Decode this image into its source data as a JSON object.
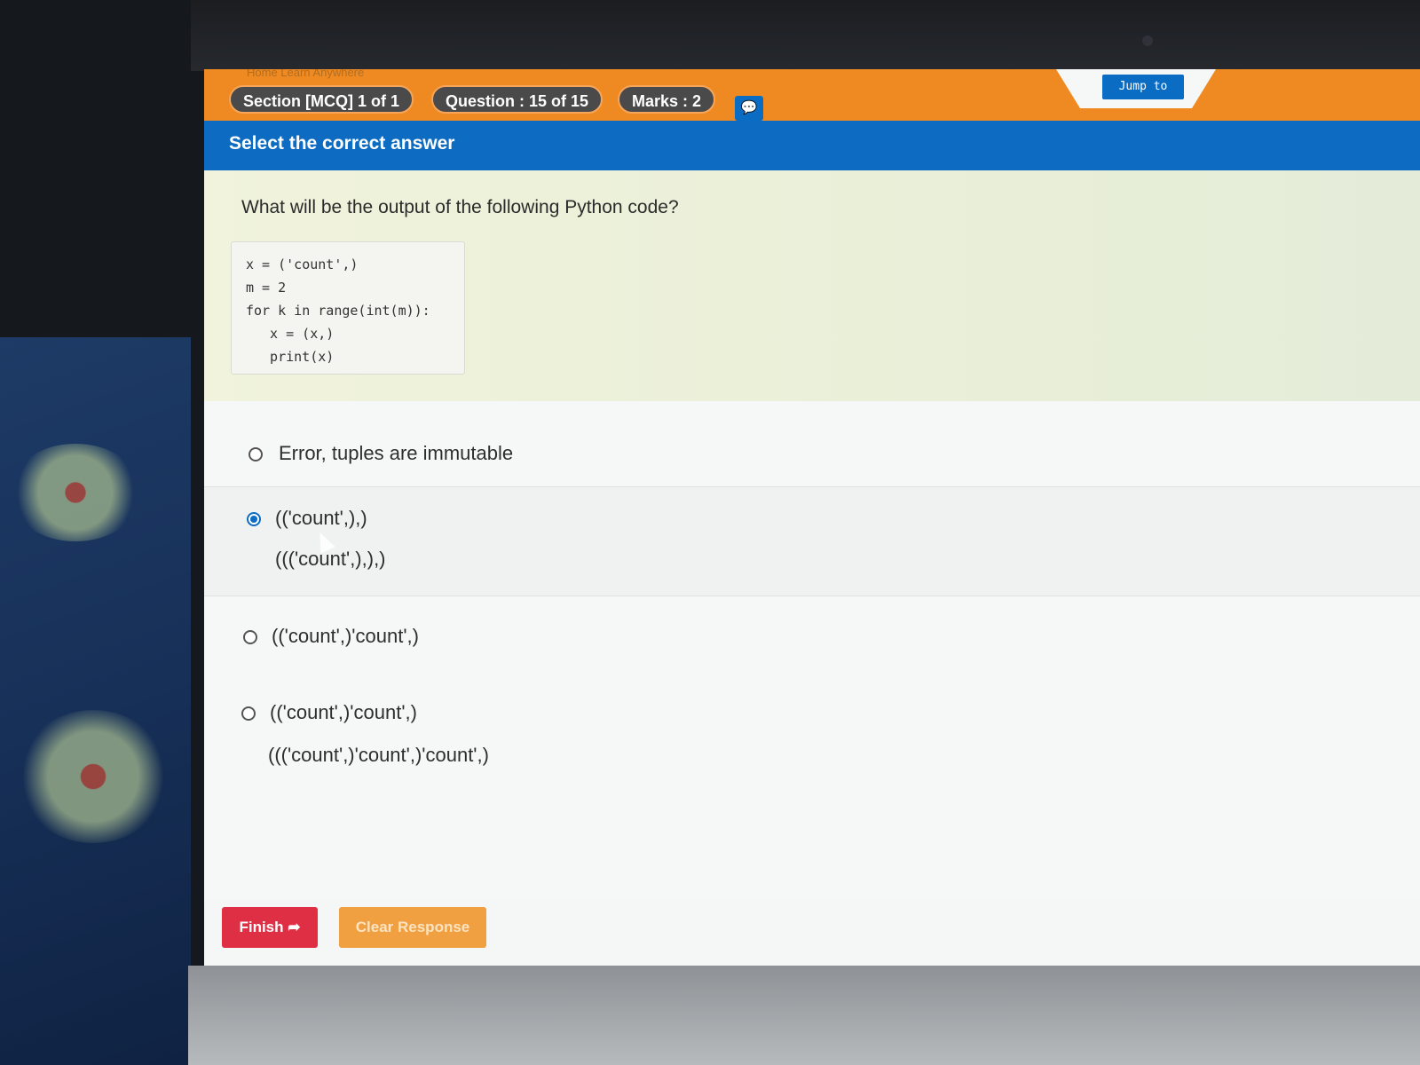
{
  "header": {
    "ghost_nav": "Home   Learn Anywhere",
    "section_label": "Section [MCQ] 1 of 1",
    "question_label": "Question : 15 of 15",
    "marks_label": "Marks : 2",
    "chat_icon": "chat-bubble-icon",
    "jump_label": "Jump to"
  },
  "instruction": "Select the correct answer",
  "question": {
    "text": "What will be the output of the following Python code?",
    "code": [
      "x = ('count',)",
      "m = 2",
      "for k in range(int(m)):",
      "  x = (x,)",
      "  print(x)"
    ]
  },
  "options": [
    {
      "lines": [
        "Error, tuples are immutable"
      ],
      "selected": false
    },
    {
      "lines": [
        "(('count',),)",
        "((('count',),),)"
      ],
      "selected": true
    },
    {
      "lines": [
        "(('count',)'count',)"
      ],
      "selected": false
    },
    {
      "lines": [
        "(('count',)'count',)",
        "((('count',)'count',)'count',)"
      ],
      "selected": false
    }
  ],
  "footer": {
    "finish_label": "Finish",
    "finish_icon": "sign-out-icon",
    "clear_label": "Clear Response"
  },
  "colors": {
    "orange_bar": "#ef8a22",
    "blue_bar": "#0d6bc2",
    "finish": "#df2f45",
    "clear": "#f0a040"
  }
}
